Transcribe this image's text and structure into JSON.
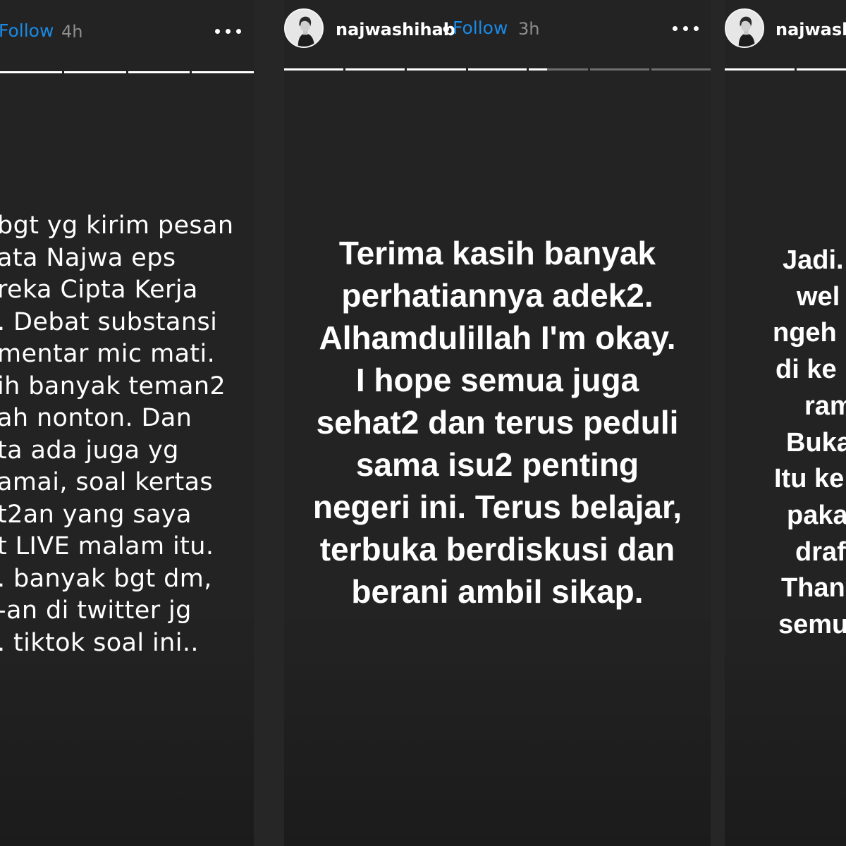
{
  "stories": [
    {
      "follow": "Follow",
      "time": "4h",
      "progress": [
        1,
        1,
        1,
        1
      ],
      "lines": [
        "bgt yg kirim pesan",
        "ata Najwa eps",
        "reka Cipta Kerja",
        ". Debat substansi",
        "mentar mic mati.",
        "ih banyak teman2",
        "ah nonton.  Dan",
        "ta ada juga yg",
        "amai, soal kertas",
        "t2an yang saya",
        "t LIVE malam itu.",
        ". banyak bgt dm,",
        "-an di twitter jg",
        ". tiktok soal ini.."
      ]
    },
    {
      "username": "najwashihab",
      "separator": "•",
      "follow": "Follow",
      "time": "3h",
      "progress": [
        1,
        1,
        1,
        1,
        0.3,
        0,
        0
      ],
      "lines": [
        "Terima kasih banyak",
        "perhatiannya adek2.",
        "Alhamdulillah I'm okay.",
        "I hope semua juga",
        "sehat2 dan terus peduli",
        "sama isu2 penting",
        "negeri ini. Terus belajar,",
        "terbuka berdiskusi dan",
        "berani ambil sikap."
      ]
    },
    {
      "username": "najwashi",
      "progress": [
        1,
        1
      ],
      "lines": [
        "Jadi.",
        "wel",
        "ngeh",
        "di ke",
        "ram",
        "Buka",
        "Itu ke",
        "paka",
        "draf",
        "Than",
        "semu"
      ]
    }
  ],
  "icons": {
    "more": "more-options-icon",
    "avatar": "profile-avatar"
  },
  "colors": {
    "background": "#222222",
    "follow": "#1a8ae6",
    "time": "#8e8e8e",
    "text": "#ffffff"
  }
}
